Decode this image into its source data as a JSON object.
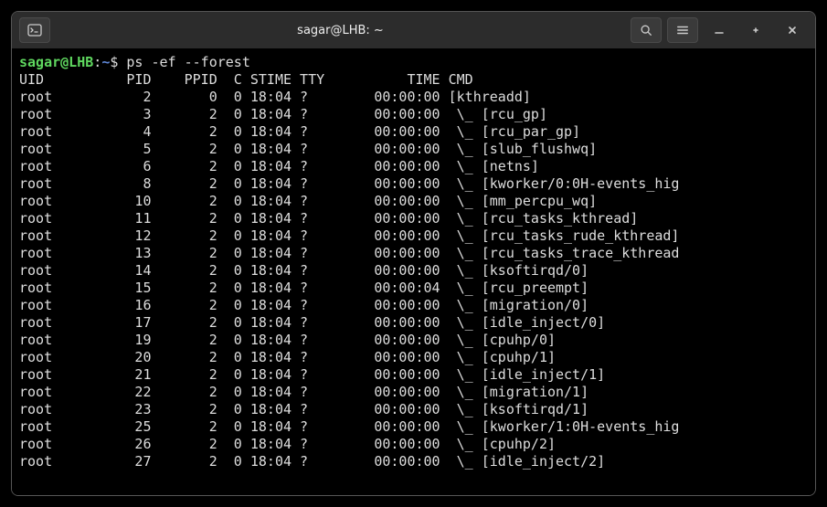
{
  "titlebar": {
    "title": "sagar@LHB: ~"
  },
  "prompt": {
    "user": "sagar",
    "host": "@LHB",
    "colon": ":",
    "path": "~",
    "dollar": "$ ",
    "command": "ps -ef --forest"
  },
  "header": "UID          PID    PPID  C STIME TTY          TIME CMD",
  "rows": [
    {
      "uid": "root",
      "pid": "2",
      "ppid": "0",
      "c": "0",
      "stime": "18:04",
      "tty": "?",
      "time": "00:00:00",
      "cmd": "[kthreadd]"
    },
    {
      "uid": "root",
      "pid": "3",
      "ppid": "2",
      "c": "0",
      "stime": "18:04",
      "tty": "?",
      "time": "00:00:00",
      "cmd": " \\_ [rcu_gp]"
    },
    {
      "uid": "root",
      "pid": "4",
      "ppid": "2",
      "c": "0",
      "stime": "18:04",
      "tty": "?",
      "time": "00:00:00",
      "cmd": " \\_ [rcu_par_gp]"
    },
    {
      "uid": "root",
      "pid": "5",
      "ppid": "2",
      "c": "0",
      "stime": "18:04",
      "tty": "?",
      "time": "00:00:00",
      "cmd": " \\_ [slub_flushwq]"
    },
    {
      "uid": "root",
      "pid": "6",
      "ppid": "2",
      "c": "0",
      "stime": "18:04",
      "tty": "?",
      "time": "00:00:00",
      "cmd": " \\_ [netns]"
    },
    {
      "uid": "root",
      "pid": "8",
      "ppid": "2",
      "c": "0",
      "stime": "18:04",
      "tty": "?",
      "time": "00:00:00",
      "cmd": " \\_ [kworker/0:0H-events_hig"
    },
    {
      "uid": "root",
      "pid": "10",
      "ppid": "2",
      "c": "0",
      "stime": "18:04",
      "tty": "?",
      "time": "00:00:00",
      "cmd": " \\_ [mm_percpu_wq]"
    },
    {
      "uid": "root",
      "pid": "11",
      "ppid": "2",
      "c": "0",
      "stime": "18:04",
      "tty": "?",
      "time": "00:00:00",
      "cmd": " \\_ [rcu_tasks_kthread]"
    },
    {
      "uid": "root",
      "pid": "12",
      "ppid": "2",
      "c": "0",
      "stime": "18:04",
      "tty": "?",
      "time": "00:00:00",
      "cmd": " \\_ [rcu_tasks_rude_kthread]"
    },
    {
      "uid": "root",
      "pid": "13",
      "ppid": "2",
      "c": "0",
      "stime": "18:04",
      "tty": "?",
      "time": "00:00:00",
      "cmd": " \\_ [rcu_tasks_trace_kthread"
    },
    {
      "uid": "root",
      "pid": "14",
      "ppid": "2",
      "c": "0",
      "stime": "18:04",
      "tty": "?",
      "time": "00:00:00",
      "cmd": " \\_ [ksoftirqd/0]"
    },
    {
      "uid": "root",
      "pid": "15",
      "ppid": "2",
      "c": "0",
      "stime": "18:04",
      "tty": "?",
      "time": "00:00:04",
      "cmd": " \\_ [rcu_preempt]"
    },
    {
      "uid": "root",
      "pid": "16",
      "ppid": "2",
      "c": "0",
      "stime": "18:04",
      "tty": "?",
      "time": "00:00:00",
      "cmd": " \\_ [migration/0]"
    },
    {
      "uid": "root",
      "pid": "17",
      "ppid": "2",
      "c": "0",
      "stime": "18:04",
      "tty": "?",
      "time": "00:00:00",
      "cmd": " \\_ [idle_inject/0]"
    },
    {
      "uid": "root",
      "pid": "19",
      "ppid": "2",
      "c": "0",
      "stime": "18:04",
      "tty": "?",
      "time": "00:00:00",
      "cmd": " \\_ [cpuhp/0]"
    },
    {
      "uid": "root",
      "pid": "20",
      "ppid": "2",
      "c": "0",
      "stime": "18:04",
      "tty": "?",
      "time": "00:00:00",
      "cmd": " \\_ [cpuhp/1]"
    },
    {
      "uid": "root",
      "pid": "21",
      "ppid": "2",
      "c": "0",
      "stime": "18:04",
      "tty": "?",
      "time": "00:00:00",
      "cmd": " \\_ [idle_inject/1]"
    },
    {
      "uid": "root",
      "pid": "22",
      "ppid": "2",
      "c": "0",
      "stime": "18:04",
      "tty": "?",
      "time": "00:00:00",
      "cmd": " \\_ [migration/1]"
    },
    {
      "uid": "root",
      "pid": "23",
      "ppid": "2",
      "c": "0",
      "stime": "18:04",
      "tty": "?",
      "time": "00:00:00",
      "cmd": " \\_ [ksoftirqd/1]"
    },
    {
      "uid": "root",
      "pid": "25",
      "ppid": "2",
      "c": "0",
      "stime": "18:04",
      "tty": "?",
      "time": "00:00:00",
      "cmd": " \\_ [kworker/1:0H-events_hig"
    },
    {
      "uid": "root",
      "pid": "26",
      "ppid": "2",
      "c": "0",
      "stime": "18:04",
      "tty": "?",
      "time": "00:00:00",
      "cmd": " \\_ [cpuhp/2]"
    },
    {
      "uid": "root",
      "pid": "27",
      "ppid": "2",
      "c": "0",
      "stime": "18:04",
      "tty": "?",
      "time": "00:00:00",
      "cmd": " \\_ [idle_inject/2]"
    }
  ]
}
